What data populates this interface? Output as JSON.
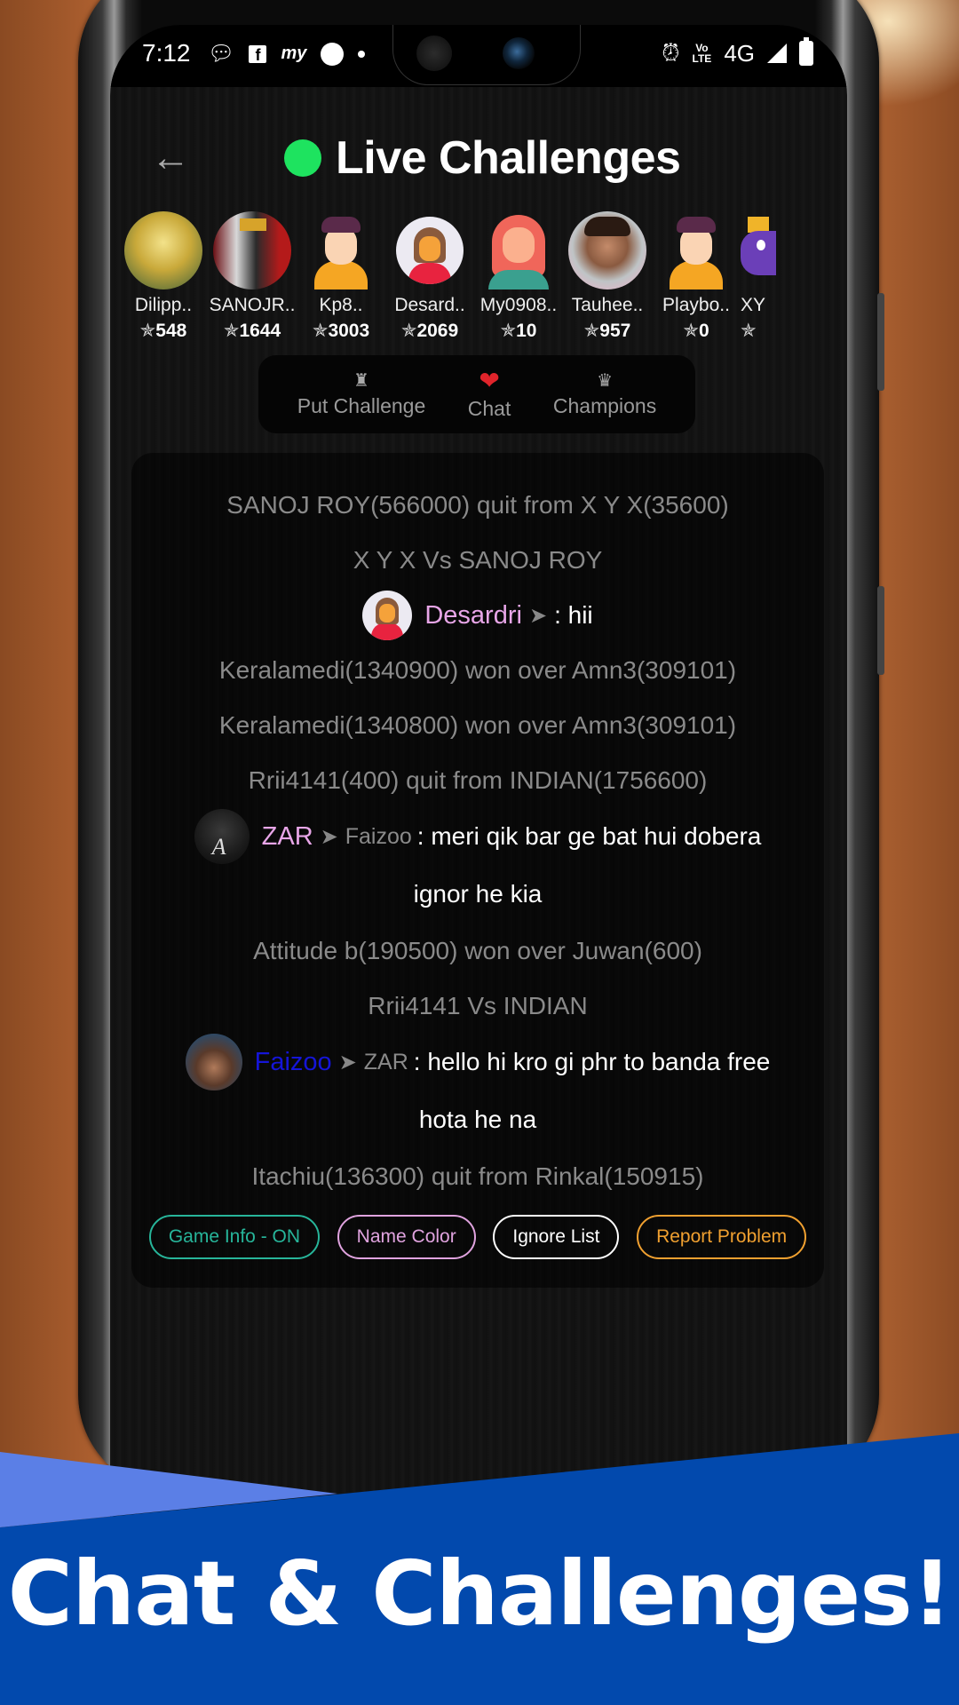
{
  "status_bar": {
    "time": "7:12",
    "left_icons": [
      "message-icon",
      "facebook-icon",
      "mytracker-icon",
      "speedometer-icon",
      "dot-icon"
    ],
    "right_icons": [
      "alarm-icon",
      "volte-icon",
      "network-4g",
      "signal-icon",
      "battery-icon"
    ],
    "volte_top": "Vo",
    "volte_bottom": "LTE",
    "network": "4G"
  },
  "header": {
    "back_icon": "←",
    "title": "Live Challenges",
    "live_indicator_color": "#1ee35f"
  },
  "players": [
    {
      "name": "Dilipp..",
      "rating": "548",
      "avatar": "deity-photo"
    },
    {
      "name": "SANOJR..",
      "rating": "1644",
      "avatar": "crown-photo"
    },
    {
      "name": "Kp8..",
      "rating": "3003",
      "avatar": "cartoon-boy"
    },
    {
      "name": "Desard..",
      "rating": "2069",
      "avatar": "cartoon-woman"
    },
    {
      "name": "My0908..",
      "rating": "10",
      "avatar": "cartoon-redhead"
    },
    {
      "name": "Tauhee..",
      "rating": "957",
      "avatar": "man-photo"
    },
    {
      "name": "Playbo..",
      "rating": "0",
      "avatar": "cartoon-boy"
    },
    {
      "name": "XY",
      "rating": "",
      "avatar": "purple-dragon"
    }
  ],
  "rating_star": "✯",
  "tabs": [
    {
      "label": "Put Challenge",
      "icon": "♜"
    },
    {
      "label": "Chat",
      "icon": "❤",
      "active": true
    },
    {
      "label": "Champions",
      "icon": "♛"
    }
  ],
  "chat": {
    "lines": [
      {
        "type": "info",
        "text": "SANOJ ROY(566000) quit from X Y X(35600)"
      },
      {
        "type": "info",
        "text": "X Y X Vs SANOJ ROY"
      },
      {
        "type": "message",
        "sender": "Desardri",
        "sender_color": "#e8a6e8",
        "target": "",
        "text": ": hii"
      },
      {
        "type": "info",
        "text": "Keralamedi(1340900) won over Amn3(309101)"
      },
      {
        "type": "info",
        "text": "Keralamedi(1340800) won over Amn3(309101)"
      },
      {
        "type": "info",
        "text": "Rrii4141(400) quit from INDIAN(1756600)"
      },
      {
        "type": "message",
        "sender": "ZAR",
        "sender_color": "#e8a6e8",
        "target": "Faizoo",
        "text": ": meri qik bar ge bat hui dobera",
        "continuation": "ignor he kia"
      },
      {
        "type": "info",
        "text": "Attitude b(190500) won over Juwan(600)"
      },
      {
        "type": "info",
        "text": "Rrii4141 Vs INDIAN"
      },
      {
        "type": "message",
        "sender": "Faizoo",
        "sender_color": "#1515d8",
        "target": "ZAR",
        "text": ": hello hi kro gi phr to banda free",
        "continuation": "hota he na"
      },
      {
        "type": "info",
        "text": "Itachiu(136300) quit from Rinkal(150915)"
      }
    ],
    "arrow_glyph": "➤"
  },
  "actions": [
    {
      "label": "Game Info - ON",
      "color": "#27b59a"
    },
    {
      "label": "Name Color",
      "color": "#e0a3df"
    },
    {
      "label": "Ignore List",
      "color": "#ffffff"
    },
    {
      "label": "Report Problem",
      "color": "#f0a030"
    }
  ],
  "banner": {
    "text": "Chat & Challenges!",
    "color": "#0249ad",
    "accent": "#5b7fe6"
  }
}
